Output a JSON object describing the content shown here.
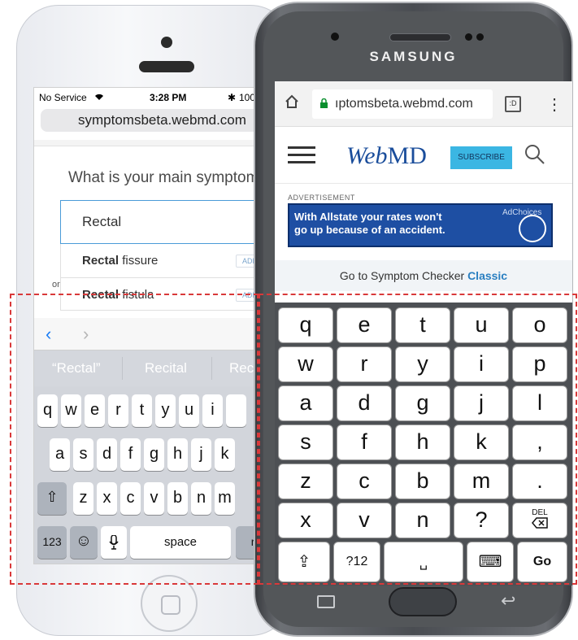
{
  "iphone": {
    "status": {
      "carrier": "No Service",
      "time": "3:28 PM",
      "battery": "100"
    },
    "url": "symptomsbeta.webmd.com",
    "question": "What is your main symptom?",
    "input_value": "Rectal",
    "suggestions": [
      {
        "bold": "Rectal",
        "rest": " fissure",
        "add": "ADD"
      },
      {
        "bold": "Rectal",
        "rest": " fistula",
        "add": "ADD"
      }
    ],
    "or_label": "or",
    "nav": {
      "back": "‹",
      "forward": "›"
    },
    "predictions": [
      "“Rectal”",
      "Recital",
      "Rec"
    ],
    "rows": [
      [
        "q",
        "w",
        "e",
        "r",
        "t",
        "y",
        "u",
        "i"
      ],
      [
        "a",
        "s",
        "d",
        "f",
        "g",
        "h",
        "j",
        "k"
      ],
      [
        "z",
        "x",
        "c",
        "v",
        "b",
        "n",
        "m"
      ]
    ],
    "keys": {
      "numbers": "123",
      "emoji": "☺",
      "mic": "🎙",
      "space": "space",
      "return": "re",
      "shift": "⇧"
    }
  },
  "samsung": {
    "brand": "SAMSUNG",
    "url": "ıptomsbeta.webmd.com",
    "tabs_count": ":D",
    "menu": "⋮",
    "logo": {
      "italic": "Web",
      "rest": "MD"
    },
    "subscribe": "SUBSCRIBE",
    "ad_label": "ADVERTISEMENT",
    "ad_text_line1": "With Allstate your rates won't",
    "ad_text_line2": "go up because of an accident.",
    "ad_choices": "AdChoices",
    "goto": "Go to Symptom Checker",
    "goto_link": "Classic",
    "grid": [
      [
        "q",
        "e",
        "t",
        "u",
        "o"
      ],
      [
        "w",
        "r",
        "y",
        "i",
        "p"
      ],
      [
        "a",
        "d",
        "g",
        "j",
        "l"
      ],
      [
        "s",
        "f",
        "h",
        "k",
        ","
      ],
      [
        "z",
        "c",
        "b",
        "m",
        "."
      ],
      [
        "x",
        "v",
        "n",
        "?",
        "DEL"
      ]
    ],
    "bottom": {
      "shift": "⇪",
      "sym": "?12",
      "space": "␣",
      "keyboard": "⌨",
      "go": "Go"
    }
  }
}
